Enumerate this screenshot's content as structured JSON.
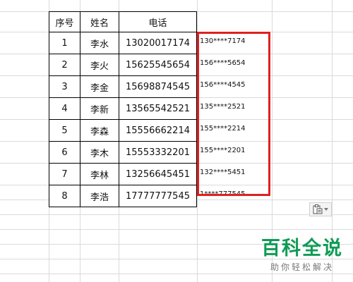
{
  "table": {
    "headers": [
      "序号",
      "姓名",
      "电话"
    ],
    "rows": [
      {
        "index": "1",
        "name": "李水",
        "phone": "13020017174",
        "masked": "130****7174"
      },
      {
        "index": "2",
        "name": "李火",
        "phone": "15625545654",
        "masked": "156****5654"
      },
      {
        "index": "3",
        "name": "李金",
        "phone": "15698874545",
        "masked": "156****4545"
      },
      {
        "index": "4",
        "name": "李新",
        "phone": "13565542521",
        "masked": "135****2521"
      },
      {
        "index": "5",
        "name": "李森",
        "phone": "15556662214",
        "masked": "155****2214"
      },
      {
        "index": "6",
        "name": "李木",
        "phone": "15553332201",
        "masked": "155****2201"
      },
      {
        "index": "7",
        "name": "李林",
        "phone": "13256645451",
        "masked": "132****5451"
      },
      {
        "index": "8",
        "name": "李浩",
        "phone": "17777777545",
        "masked": "1****777545"
      }
    ]
  },
  "highlight_color": "#e02020",
  "paste_options": {
    "icon": "paste-options-icon"
  },
  "watermark": {
    "title": "百科全说",
    "subtitle": "助你轻松解决",
    "color": "#0f9b55"
  }
}
